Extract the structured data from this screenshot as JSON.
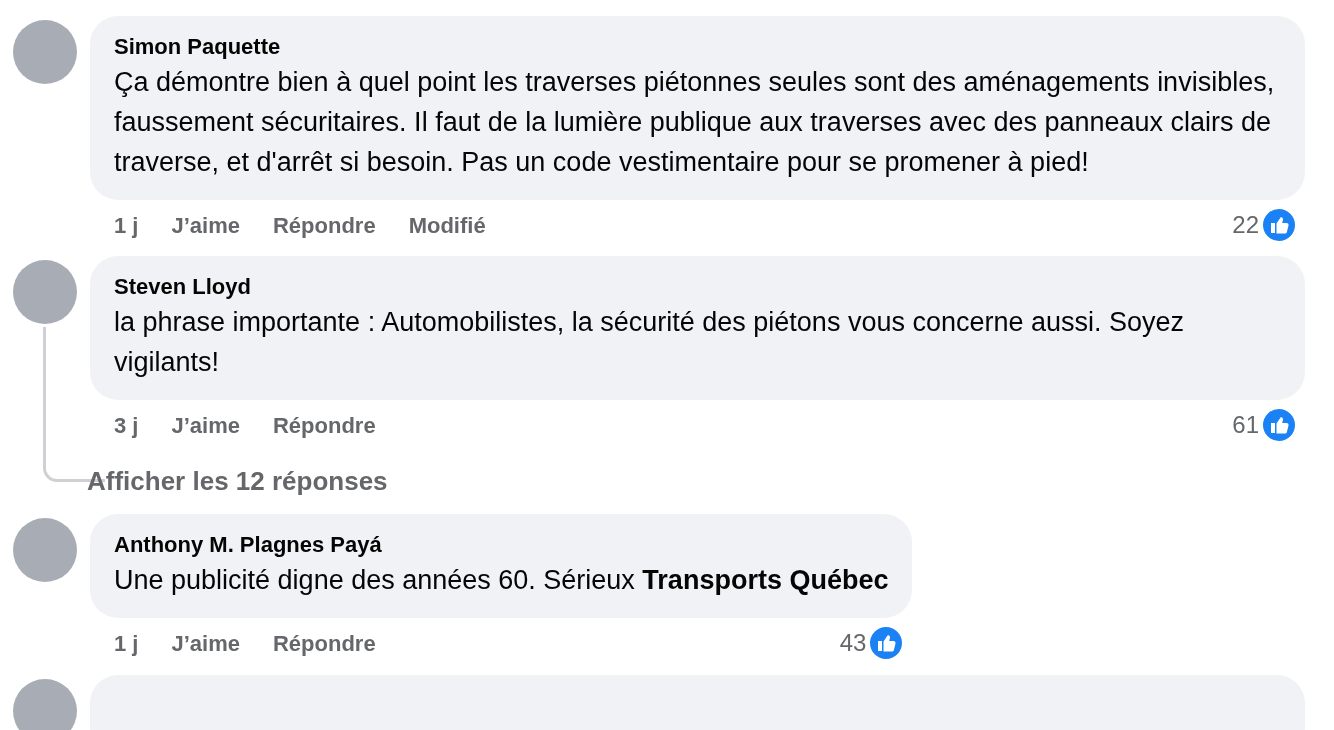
{
  "comments": [
    {
      "kind": "comment",
      "author": "Simon Paquette",
      "text": "Ça démontre bien à quel point les traverses piétonnes seules sont des aménagements invisibles, faussement sécuritaires. Il faut de la lumière publique aux traverses avec des panneaux clairs de traverse, et d'arrêt si besoin. Pas un code vestimentaire pour se promener à pied!",
      "time": "1 j",
      "like_label": "J’aime",
      "reply_label": "Répondre",
      "edited_label": "Modifié",
      "reaction_count": "22"
    },
    {
      "kind": "comment",
      "author": "Steven Lloyd",
      "text": "la phrase importante : Automobilistes, la sécurité des piétons vous concerne aussi. Soyez vigilants!",
      "time": "3 j",
      "like_label": "J’aime",
      "reply_label": "Répondre",
      "reaction_count": "61",
      "replies_link": "Afficher les 12 réponses"
    },
    {
      "kind": "comment",
      "author": "Anthony M. Plagnes Payá",
      "text": "Une publicité digne des années 60. Sérieux **Transports Québec**",
      "time": "1 j",
      "like_label": "J’aime",
      "reply_label": "Répondre",
      "reaction_count": "43"
    },
    {
      "kind": "partial"
    }
  ]
}
